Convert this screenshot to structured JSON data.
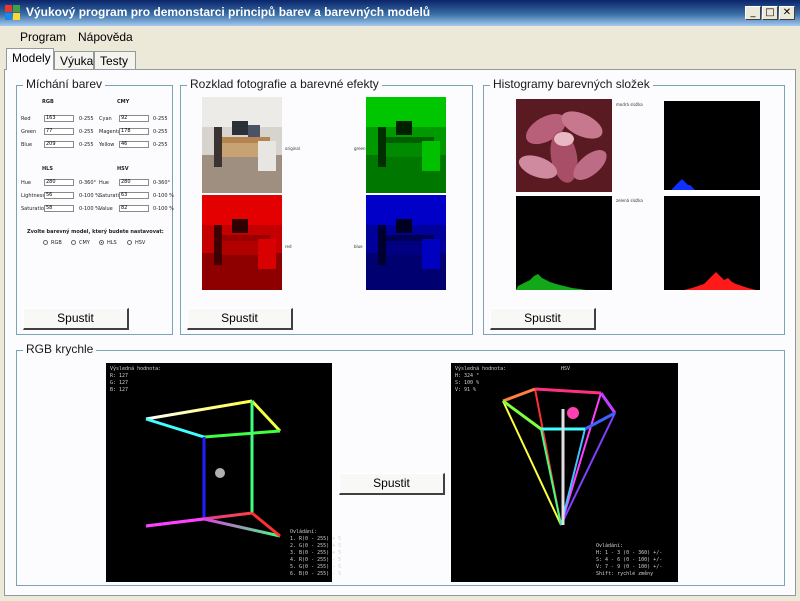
{
  "window": {
    "title": "Výukový program pro demonstarci principů barev a barevných modelů",
    "minimize_glyph": "_",
    "maximize_glyph": "□",
    "close_glyph": "✕"
  },
  "menu": {
    "items": [
      {
        "label": "Program"
      },
      {
        "label": "Nápověda"
      }
    ]
  },
  "tabs": [
    {
      "label": "Modely"
    },
    {
      "label": "Výuka"
    },
    {
      "label": "Testy"
    }
  ],
  "mixing": {
    "title": "Míchání barev",
    "run_label": "Spustit",
    "rgb": {
      "header": "RGB",
      "labels": [
        "Red",
        "Green",
        "Blue"
      ],
      "values": [
        "163",
        "77",
        "209"
      ],
      "ranges": [
        "0-255",
        "0-255",
        "0-255"
      ]
    },
    "cmy": {
      "header": "CMY",
      "labels": [
        "Cyan",
        "Magenta",
        "Yellow"
      ],
      "values": [
        "92",
        "178",
        "46"
      ],
      "ranges": [
        "0-255",
        "0-255",
        "0-255"
      ]
    },
    "hls": {
      "header": "HLS",
      "labels": [
        "Hue",
        "Lightness",
        "Saturation"
      ],
      "values": [
        "280",
        "56",
        "58"
      ],
      "ranges": [
        "0-360°",
        "0-100 %",
        "0-100 %"
      ]
    },
    "hsv": {
      "header": "HSV",
      "labels": [
        "Hue",
        "Saturation",
        "Value"
      ],
      "values": [
        "280",
        "63",
        "82"
      ],
      "ranges": [
        "0-360°",
        "0-100 %",
        "0-100 %"
      ]
    },
    "choose_label": "Zvolte barevný model, který budete nastavovat:",
    "models": [
      "RGB",
      "CMY",
      "HLS",
      "HSV"
    ],
    "selected_model": "HLS"
  },
  "decomposition": {
    "title": "Rozklad fotografie a barevné efekty",
    "run_label": "Spustit",
    "labels": [
      "original",
      "green",
      "red",
      "blue"
    ]
  },
  "histograms": {
    "title": "Histogramy barevných složek",
    "run_label": "Spustit",
    "labels": [
      "modrá složka",
      "zelená složka"
    ]
  },
  "rgb_cube": {
    "title": "RGB krychle",
    "run_label": "Spustit",
    "left_header": "Výsledná hodnota:",
    "left_values": "R: 127\nG: 127\nB: 127",
    "left_legend": "Ovládání:\n1. R(0 - 255) + 5\n2. G(0 - 255) + 5\n3. B(0 - 255) + 5\n4. R(0 - 255) - 5\n5. G(0 - 255) - 5\n6. B(0 - 255) - 5",
    "right_header": "Výsledná hodnota:",
    "right_model": "HSV",
    "right_values": "H: 324 °\nS: 100 %\nV: 91 %",
    "right_legend": "Ovládání:\nH: 1 - 3 (0 - 360) +/-\nS: 4 - 6 (0 - 100) +/-\nV: 7 - 9 (0 - 100) +/-\nShift: rychlé změny"
  },
  "colors": {
    "title_gradient_start": "#0A246A",
    "title_gradient_end": "#A6CAF0",
    "groupbox_border": "#7BA2B5",
    "panel_bg": "#FCFCFE",
    "chrome_bg": "#ECE9D8"
  }
}
